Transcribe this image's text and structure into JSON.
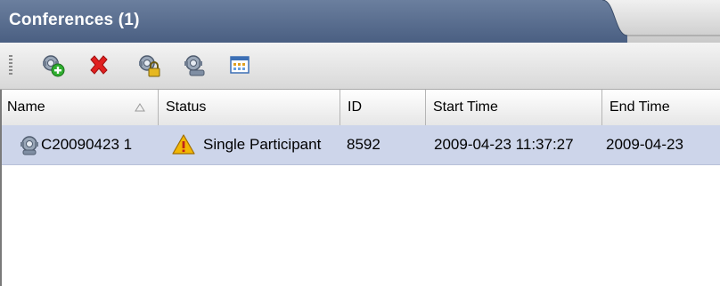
{
  "panel": {
    "title": "Conferences (1)"
  },
  "toolbar": {
    "buttons": [
      {
        "name": "add-conference",
        "icon": "conference-add-icon"
      },
      {
        "name": "delete-conference",
        "icon": "delete-x-icon"
      },
      {
        "name": "lock-conference",
        "icon": "conference-lock-icon"
      },
      {
        "name": "conference-properties",
        "icon": "conference-properties-icon"
      },
      {
        "name": "calendar-view",
        "icon": "calendar-icon"
      }
    ]
  },
  "table": {
    "columns": [
      "Name",
      "Status",
      "ID",
      "Start Time",
      "End Time"
    ],
    "sorted_column": "Name",
    "sort_direction": "ascending",
    "rows": [
      {
        "name": "C20090423 1",
        "status": "Single Participant",
        "status_icon": "warning-icon",
        "id": "8592",
        "start_time": "2009-04-23 11:37:27",
        "end_time": "2009-04-23"
      }
    ]
  },
  "colors": {
    "title_bar": "#4a5f82",
    "selected_row": "#cdd5ea",
    "delete_red": "#e02020",
    "warning_yellow": "#f2b705"
  }
}
